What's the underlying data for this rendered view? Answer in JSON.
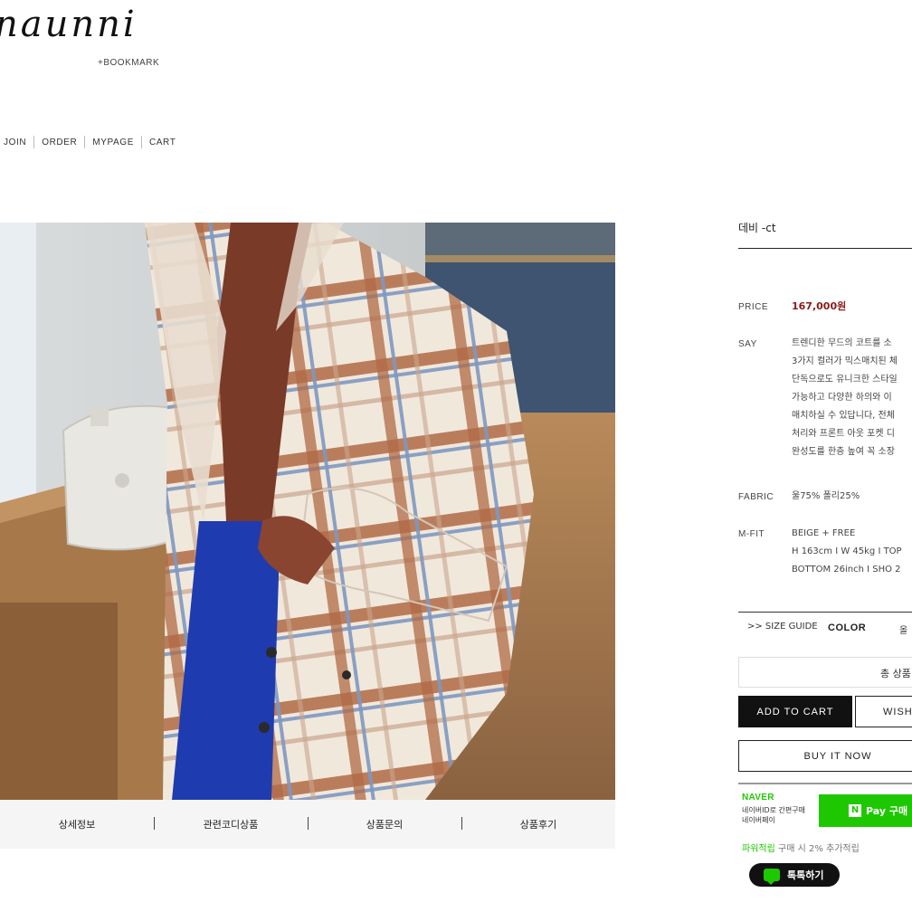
{
  "header": {
    "logo_text": "naunni",
    "bookmark": "+BOOKMARK",
    "nav": [
      "JOIN",
      "ORDER",
      "MYPAGE",
      "CART"
    ]
  },
  "detail_tabs": [
    "상세정보",
    "관련코디상품",
    "상품문의",
    "상품후기"
  ],
  "product": {
    "name": "데비 -ct",
    "price_label": "PRICE",
    "price": "167,000원",
    "say_label": "SAY",
    "say_lines": [
      "트렌디한 무드의 코트를 소",
      "3가지 컬러가 믹스매치된 체",
      "단독으로도 유니크한 스타일",
      "가능하고 다양한 하의와 이",
      "매치하실 수 있답니다, 전체",
      "처리와 프론트 아웃 포켓 디",
      "완성도를 한층 높여 꼭 소장"
    ],
    "fabric_label": "FABRIC",
    "fabric": "울75% 폴리25%",
    "mfit_label": "M-FIT",
    "mfit_lines": [
      "BEIGE + FREE",
      "H 163cm I W 45kg I TOP",
      "BOTTOM 26inch I SHO 2"
    ],
    "size_guide": ">> SIZE GUIDE",
    "color_label": "COLOR",
    "color_value": "올",
    "total": "총 상품",
    "add_to_cart": "ADD TO CART",
    "wish": "WISH",
    "buy_now": "BUY IT NOW"
  },
  "naver": {
    "logo": "NAVER",
    "sub1": "네이버ID로 간편구매",
    "sub2": "네이버페이",
    "npay_label": "Pay 구매",
    "point_label": "파워적립",
    "point_text": "구매 시 2% 추가적립",
    "talk": "톡톡하기"
  },
  "colors": {
    "price": "#8b1a1a",
    "naver_green": "#1ec800",
    "cart_button": "#111111"
  }
}
